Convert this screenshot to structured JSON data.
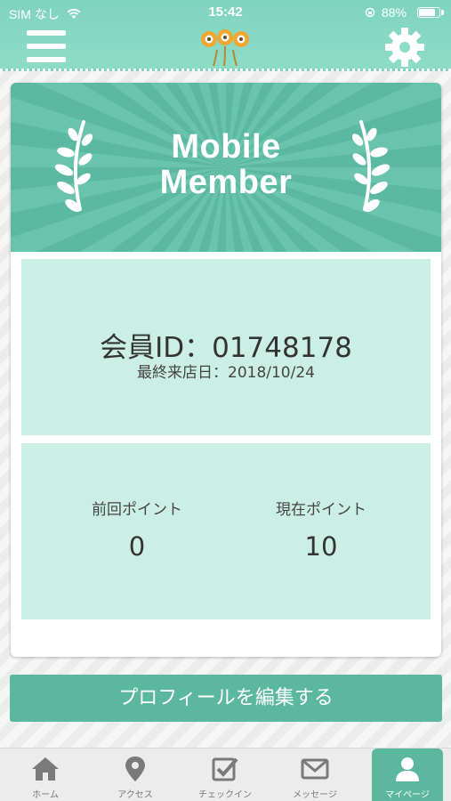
{
  "status_bar": {
    "carrier": "SIM なし",
    "time": "15:42",
    "battery_text": "88%",
    "battery_level": 0.88
  },
  "header": {
    "menu_icon": "hamburger-menu-icon",
    "logo": "character-logo",
    "settings_icon": "gear-icon"
  },
  "hero": {
    "title_line1": "Mobile",
    "title_line2": "Member"
  },
  "member": {
    "id_text": "会員ID：01748178",
    "last_visit_text": "最終来店日：2018/10/24"
  },
  "points": {
    "previous_label": "前回ポイント",
    "previous_value": "0",
    "current_label": "現在ポイント",
    "current_value": "10"
  },
  "edit_profile_label": "プロフィールを編集する",
  "tabs": [
    {
      "label": "ホーム",
      "icon": "home-icon"
    },
    {
      "label": "アクセス",
      "icon": "location-pin-icon"
    },
    {
      "label": "チェックイン",
      "icon": "checkbox-icon"
    },
    {
      "label": "メッセージ",
      "icon": "envelope-icon"
    },
    {
      "label": "マイページ",
      "icon": "user-icon",
      "active": true
    }
  ],
  "colors": {
    "header": "#8ddcc6",
    "accent": "#5bb89f",
    "panel": "#ccefe5"
  }
}
